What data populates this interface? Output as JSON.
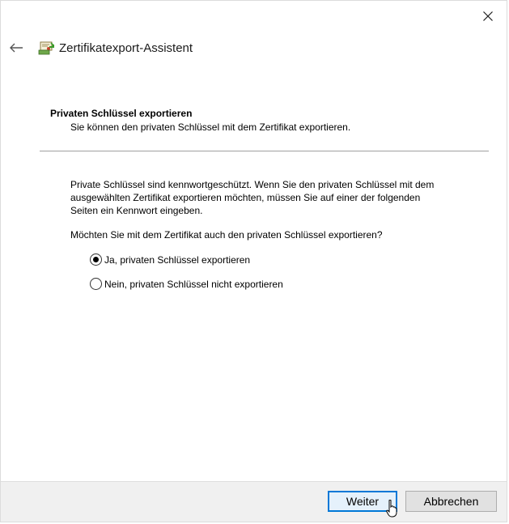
{
  "window": {
    "title": "Zertifikatexport-Assistent",
    "close_icon": "close-icon",
    "back_icon": "back-arrow-icon",
    "app_icon": "certificate-wizard-icon"
  },
  "page": {
    "heading": "Privaten Schlüssel exportieren",
    "subheading": "Sie können den privaten Schlüssel mit dem Zertifikat exportieren.",
    "description_lines": [
      "Private Schlüssel sind kennwortgeschützt. Wenn Sie den privaten Schlüssel mit dem",
      "ausgewählten Zertifikat exportieren möchten, müssen Sie auf einer der folgenden",
      "Seiten ein Kennwort eingeben."
    ],
    "question": "Möchten Sie mit dem Zertifikat auch den privaten Schlüssel exportieren?",
    "options": [
      {
        "label": "Ja, privaten Schlüssel exportieren",
        "selected": true
      },
      {
        "label": "Nein, privaten Schlüssel nicht exportieren",
        "selected": false
      }
    ]
  },
  "footer": {
    "next_label": "Weiter",
    "cancel_label": "Abbrechen"
  },
  "colors": {
    "accent": "#0078d7",
    "footer_bg": "#f0f0f0",
    "divider": "#a0a0a0"
  }
}
